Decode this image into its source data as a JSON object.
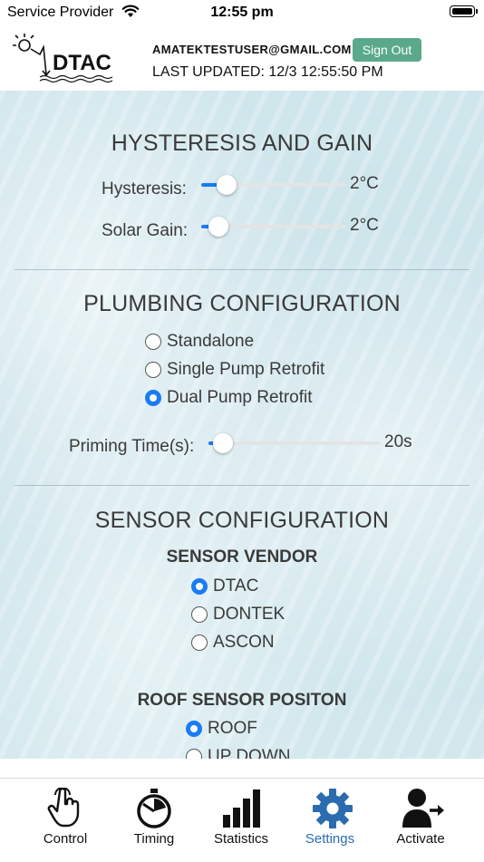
{
  "status": {
    "carrier": "Service Provider",
    "time": "12:55 pm"
  },
  "header": {
    "logo_text": "DTAC",
    "email": "AMATEKTESTUSER@GMAIL.COM",
    "sign_out_label": "Sign Out",
    "last_updated": "LAST UPDATED: 12/3 12:55:50 PM"
  },
  "hysteresis": {
    "title": "HYSTERESIS AND GAIN",
    "hysteresis_label": "Hysteresis:",
    "hysteresis_value": "2°C",
    "hysteresis_fraction": 0.12,
    "solar_gain_label": "Solar Gain:",
    "solar_gain_value": "2°C",
    "solar_gain_fraction": 0.06
  },
  "plumbing": {
    "title": "PLUMBING CONFIGURATION",
    "options": [
      "Standalone",
      "Single Pump Retrofit",
      "Dual Pump Retrofit"
    ],
    "selected": "Dual Pump Retrofit",
    "priming_label": "Priming Time(s):",
    "priming_value": "20s",
    "priming_fraction": 0.03
  },
  "sensor": {
    "title": "SENSOR CONFIGURATION",
    "vendor_title": "SENSOR VENDOR",
    "vendors": [
      "DTAC",
      "DONTEK",
      "ASCON"
    ],
    "vendor_selected": "DTAC",
    "roof_title": "ROOF SENSOR POSITON",
    "roof_options": [
      "ROOF",
      "UP DOWN"
    ],
    "roof_selected": "ROOF"
  },
  "tabs": [
    {
      "label": "Control",
      "icon": "hand-pointer-icon"
    },
    {
      "label": "Timing",
      "icon": "stopwatch-icon"
    },
    {
      "label": "Statistics",
      "icon": "bar-chart-icon"
    },
    {
      "label": "Settings",
      "icon": "gear-icon"
    },
    {
      "label": "Activate",
      "icon": "user-arrow-icon"
    }
  ],
  "active_tab": "Settings",
  "colors": {
    "accent": "#1a7cf5",
    "sign_out": "#5aa98a",
    "active_tab": "#2b6cb0"
  }
}
